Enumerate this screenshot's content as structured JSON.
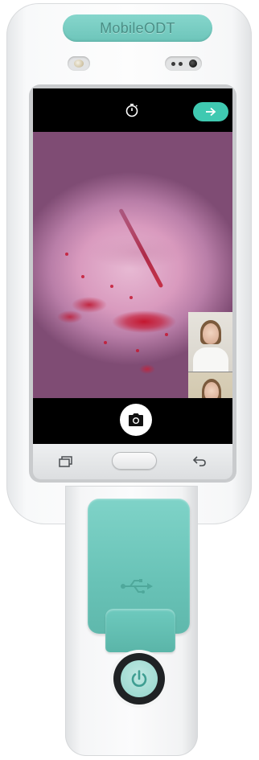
{
  "device": {
    "brand": "MobileODT"
  },
  "colors": {
    "accent_teal": "#3fc9b1",
    "device_teal": "#6dc5ba",
    "screen_background": "#000000"
  },
  "camera_app": {
    "top_bar": {
      "timer_icon": "stopwatch-icon",
      "next_button_icon": "arrow-right-icon"
    },
    "bottom_bar": {
      "capture_button_icon": "camera-icon"
    },
    "video_call": {
      "participants": 2
    }
  },
  "android_nav": {
    "recents_icon": "recents-icon",
    "home_button": "home-button",
    "back_icon": "back-icon"
  },
  "hardware": {
    "port_icon": "usb-icon",
    "power_icon": "power-icon"
  }
}
